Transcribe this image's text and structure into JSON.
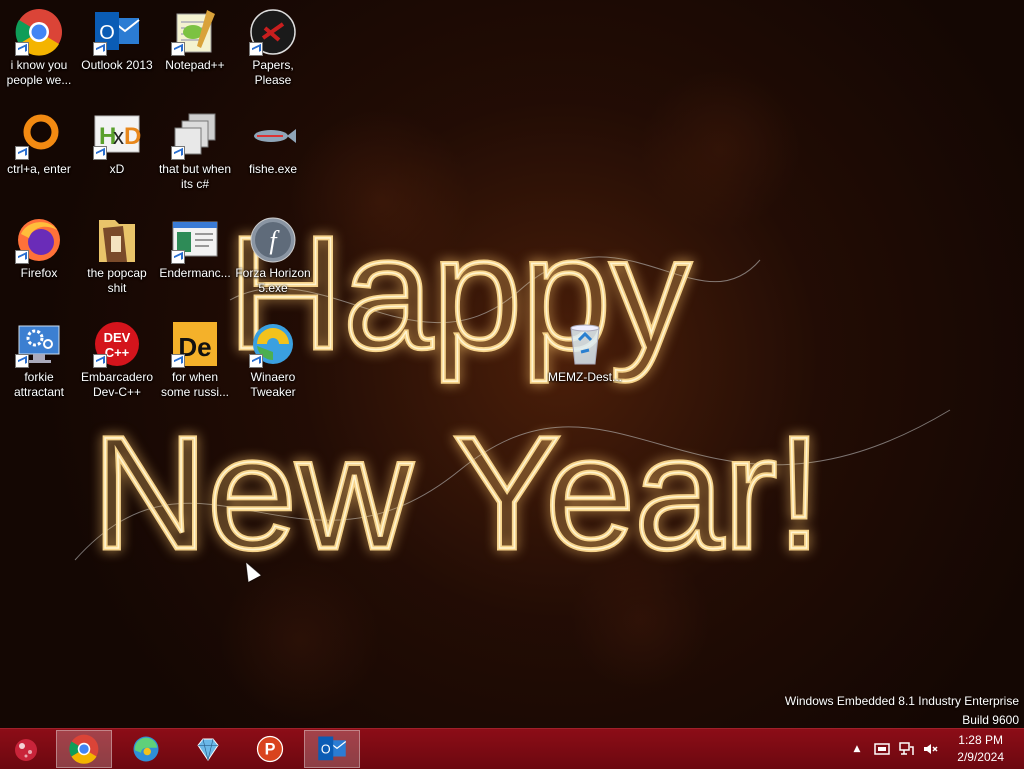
{
  "desktop": {
    "icons": [
      {
        "name": "chrome-shortcut",
        "label": "i know you people we...",
        "icon": "chrome-icon"
      },
      {
        "name": "outlook-shortcut",
        "label": "Outlook 2013",
        "icon": "outlook-icon"
      },
      {
        "name": "notepadpp-shortcut",
        "label": "Notepad++",
        "icon": "notepadpp-icon"
      },
      {
        "name": "papers-please-shortcut",
        "label": "Papers, Please",
        "icon": "papers-please-icon"
      },
      {
        "name": "ctrl-a-enter-shortcut",
        "label": "ctrl+a, enter",
        "icon": "orange-ring-icon"
      },
      {
        "name": "hxd-shortcut",
        "label": "xD",
        "icon": "hxd-icon"
      },
      {
        "name": "csharp-shortcut",
        "label": "that but when its c#",
        "icon": "window-stack-icon"
      },
      {
        "name": "fishe-shortcut",
        "label": "fishe.exe",
        "icon": "fish-icon"
      },
      {
        "name": "firefox-shortcut",
        "label": "Firefox",
        "icon": "firefox-icon"
      },
      {
        "name": "popcap-folder",
        "label": "the popcap shit",
        "icon": "folder-icon"
      },
      {
        "name": "endermanch-shortcut",
        "label": "Endermanc...",
        "icon": "window-app-icon"
      },
      {
        "name": "forza-shortcut",
        "label": "Forza Horizon 5.exe",
        "icon": "flash-icon"
      },
      {
        "name": "forkie-shortcut",
        "label": "forkie attractant",
        "icon": "settings-monitor-icon"
      },
      {
        "name": "devcpp-shortcut",
        "label": "Embarcadero Dev-C++",
        "icon": "devcpp-icon"
      },
      {
        "name": "de-shortcut",
        "label": "for when some russi...",
        "icon": "de-icon"
      },
      {
        "name": "winaero-shortcut",
        "label": "Winaero Tweaker",
        "icon": "winaero-icon"
      },
      {
        "name": "memz-recycle-bin",
        "label": "MEMZ-Dest...",
        "icon": "recycle-bin-icon"
      }
    ],
    "wallpaper_text": {
      "line1": "Happy",
      "line2": "New Year!"
    },
    "watermark": {
      "line1": "Windows Embedded 8.1 Industry Enterprise",
      "line2": "Build 9600"
    }
  },
  "taskbar": {
    "start_icon": "start-orb-icon",
    "pinned": [
      {
        "name": "chrome",
        "icon": "chrome-icon",
        "active": true
      },
      {
        "name": "edge",
        "icon": "edge-icon",
        "active": false
      },
      {
        "name": "crystal-app",
        "icon": "diamond-icon",
        "active": false
      },
      {
        "name": "p-app",
        "icon": "p-app-icon",
        "active": false
      },
      {
        "name": "outlook",
        "icon": "outlook-icon",
        "active": true
      }
    ],
    "tray": {
      "show_hidden": "▲",
      "time": "1:28 PM",
      "date": "2/9/2024"
    }
  },
  "colors": {
    "taskbar": "#7c0a13",
    "label_text": "#ffffff",
    "lights": "#f6d38a"
  }
}
